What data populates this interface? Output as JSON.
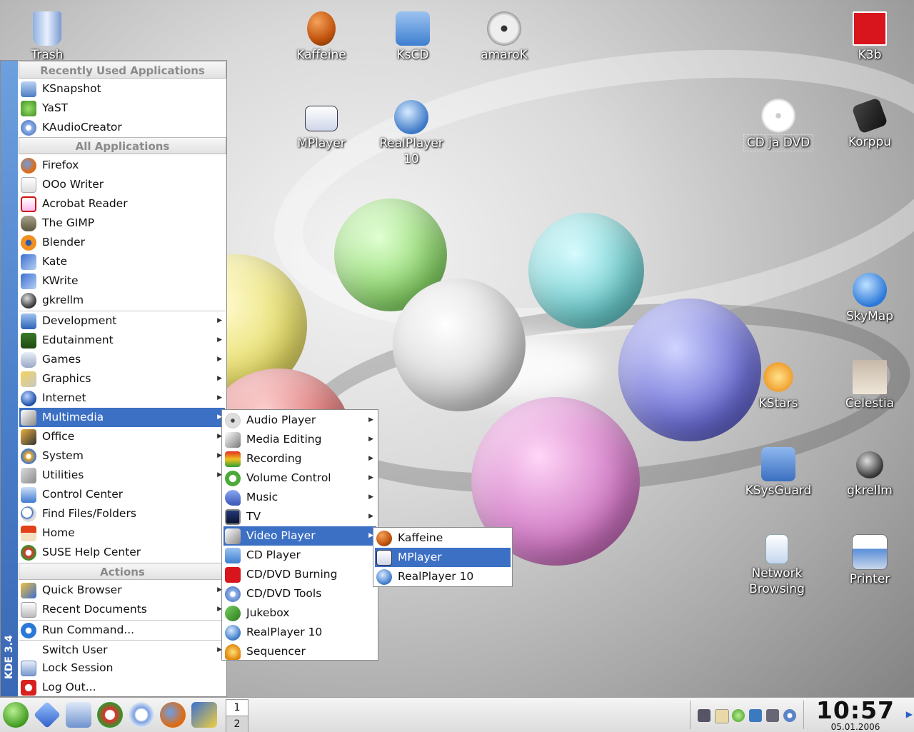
{
  "desktop": {
    "icons": [
      {
        "name": "trash-icon",
        "label": "Trash"
      },
      {
        "name": "kaffeine-desktop-icon",
        "label": "Kaffeine"
      },
      {
        "name": "kscd-desktop-icon",
        "label": "KsCD"
      },
      {
        "name": "amarok-desktop-icon",
        "label": "amaroK"
      },
      {
        "name": "k3b-desktop-icon",
        "label": "K3b"
      },
      {
        "name": "mplayer-desktop-icon",
        "label": "MPlayer"
      },
      {
        "name": "realplayer-desktop-icon",
        "label": "RealPlayer 10"
      },
      {
        "name": "cd-dvd-desktop-icon",
        "label": "CD ja DVD"
      },
      {
        "name": "korppu-desktop-icon",
        "label": "Korppu"
      },
      {
        "name": "skymap-desktop-icon",
        "label": "SkyMap"
      },
      {
        "name": "kstars-desktop-icon",
        "label": "KStars"
      },
      {
        "name": "celestia-desktop-icon",
        "label": "Celestia"
      },
      {
        "name": "ksysguard-desktop-icon",
        "label": "KSysGuard"
      },
      {
        "name": "gkrellm-desktop-icon",
        "label": "gkrellm"
      },
      {
        "name": "network-browsing-desktop-icon",
        "label": "Network Browsing"
      },
      {
        "name": "printer-desktop-icon",
        "label": "Printer"
      }
    ]
  },
  "kmenu": {
    "version_label": "KDE 3.4",
    "recent_header": "Recently Used Applications",
    "recent": [
      "KSnapshot",
      "YaST",
      "KAudioCreator"
    ],
    "all_header": "All Applications",
    "apps": [
      "Firefox",
      "OOo Writer",
      "Acrobat Reader",
      "The GIMP",
      "Blender",
      "Kate",
      "KWrite",
      "gkrellm"
    ],
    "categories": [
      "Development",
      "Edutainment",
      "Games",
      "Graphics",
      "Internet",
      "Multimedia",
      "Office",
      "System",
      "Utilities"
    ],
    "links": [
      "Control Center",
      "Find Files/Folders",
      "Home",
      "SUSE Help Center"
    ],
    "actions_header": "Actions",
    "actions": [
      "Quick Browser",
      "Recent Documents",
      "Run Command..."
    ],
    "session": [
      "Switch User",
      "Lock Session",
      "Log Out..."
    ],
    "selected": "Multimedia"
  },
  "multimedia_menu": {
    "items": [
      "Audio Player",
      "Media Editing",
      "Recording",
      "Volume Control",
      "Music",
      "TV",
      "Video Player",
      "CD Player",
      "CD/DVD Burning",
      "CD/DVD Tools",
      "Jukebox",
      "RealPlayer 10",
      "Sequencer"
    ],
    "selected": "Video Player"
  },
  "video_menu": {
    "items": [
      "Kaffeine",
      "MPlayer",
      "RealPlayer 10"
    ],
    "selected": "MPlayer"
  },
  "taskbar": {
    "pager": [
      "1",
      "2"
    ],
    "clock_time": "10:57",
    "clock_date": "05.01.2006"
  }
}
